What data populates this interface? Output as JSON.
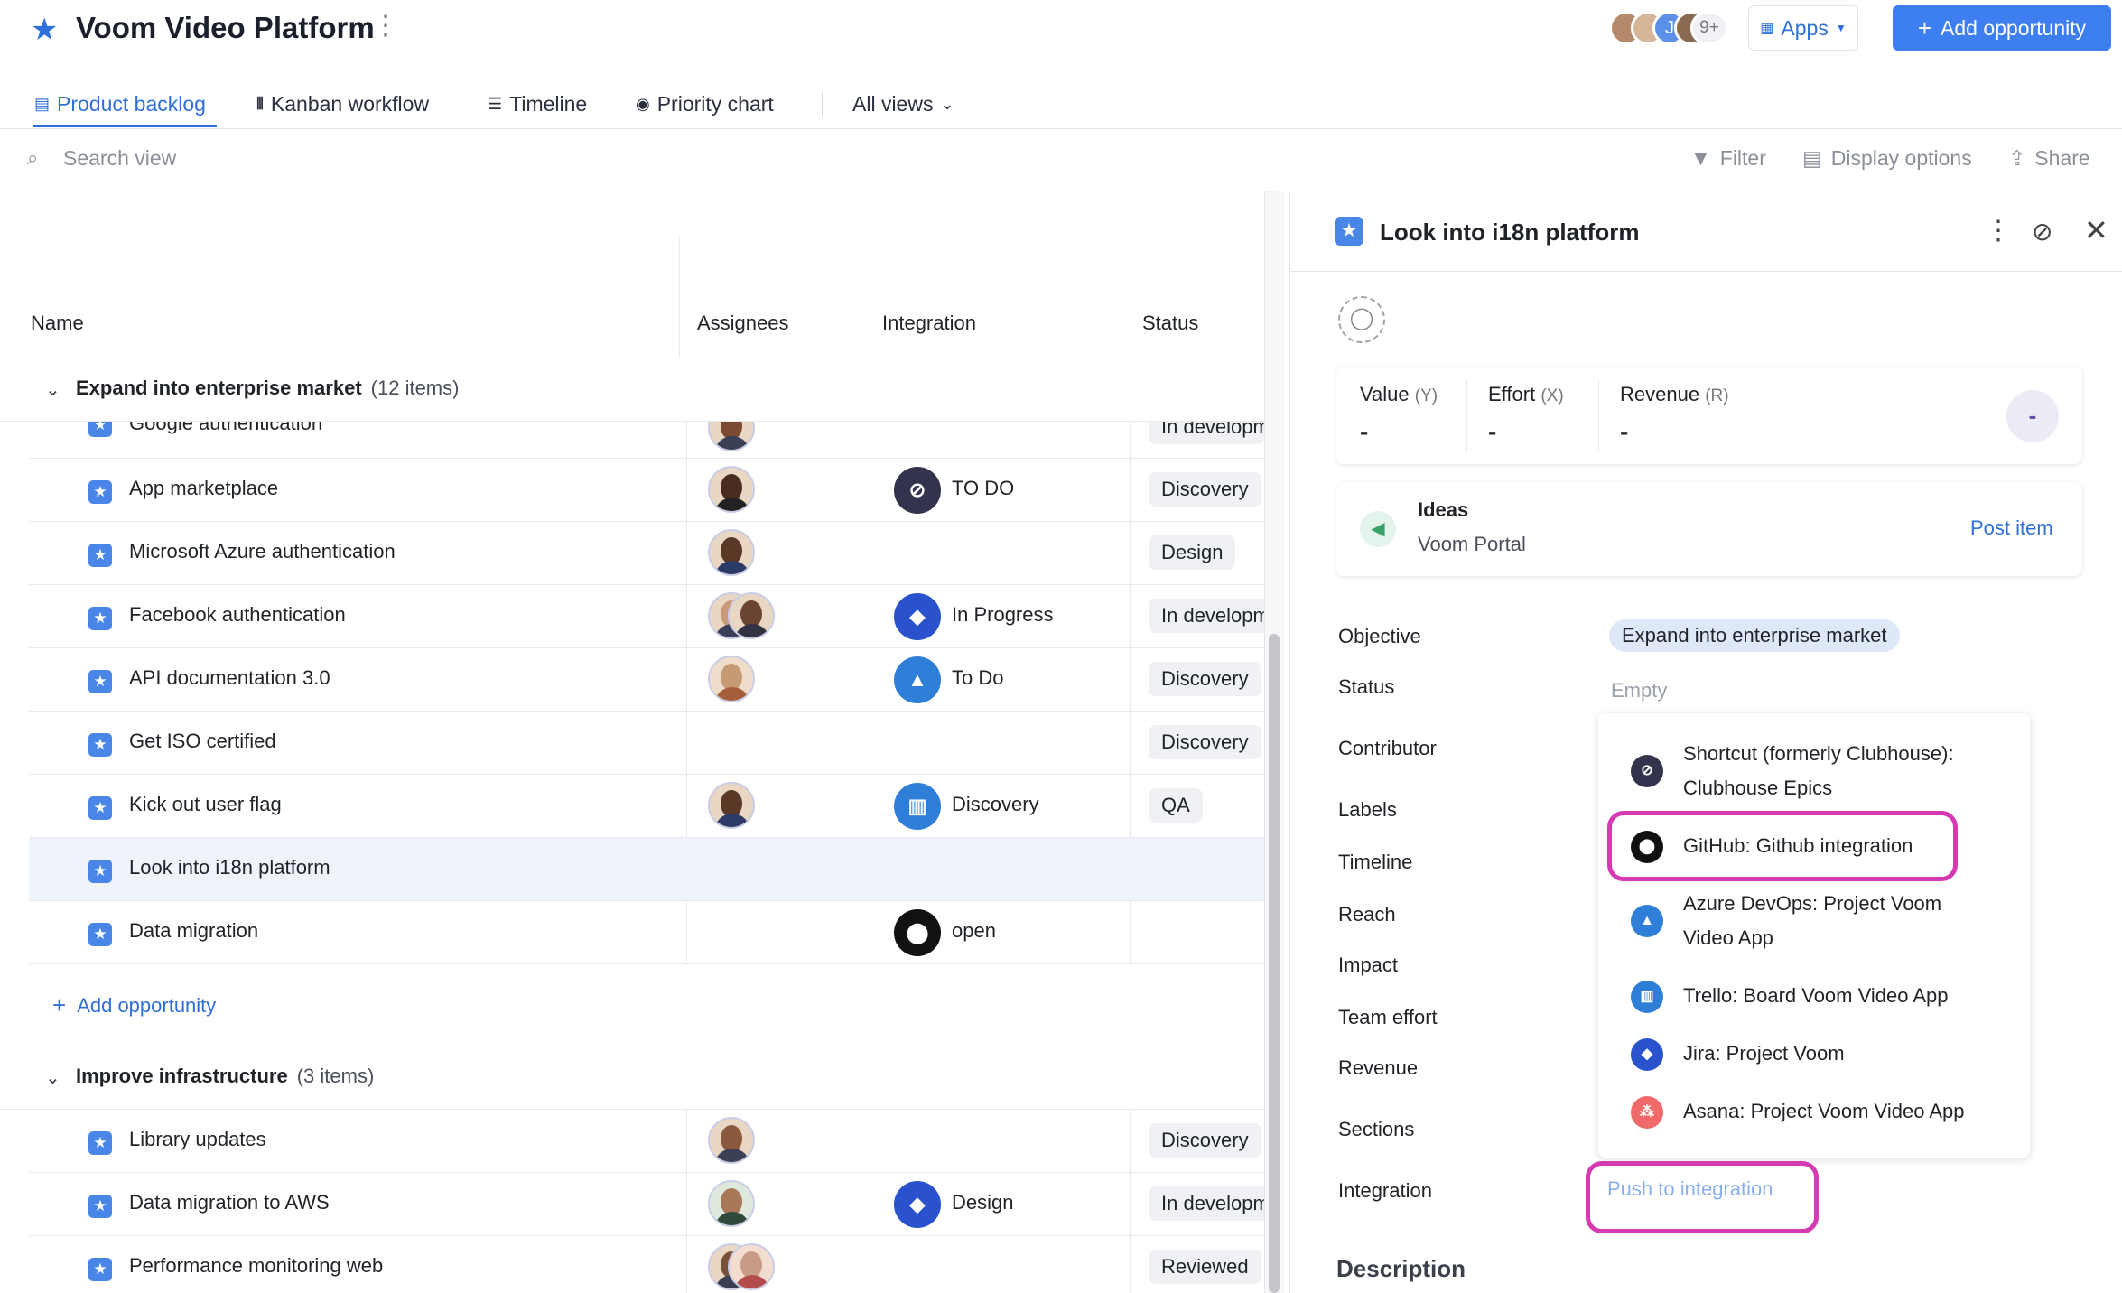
{
  "app": {
    "title": "Voom Video Platform",
    "avatar_overflow": "9+",
    "avatar_initial": "J",
    "apps_label": "Apps",
    "add_opportunity_label": "Add opportunity"
  },
  "tabs": [
    {
      "label": "Product backlog",
      "icon": "table-icon",
      "active": true
    },
    {
      "label": "Kanban workflow",
      "icon": "kanban-icon"
    },
    {
      "label": "Timeline",
      "icon": "timeline-icon"
    },
    {
      "label": "Priority chart",
      "icon": "target-icon"
    },
    {
      "label": "All views",
      "icon": "chevron-down-icon"
    }
  ],
  "toolbar": {
    "search_placeholder": "Search view",
    "filter": "Filter",
    "display_options": "Display options",
    "share": "Share"
  },
  "table": {
    "columns": [
      "Name",
      "Assignees",
      "Integration",
      "Status"
    ],
    "groups": [
      {
        "title": "Expand into enterprise market",
        "count": "(12 items)"
      },
      {
        "title": "Improve infrastructure",
        "count": "(3 items)"
      }
    ],
    "rows": [
      {
        "name": "Google authentication",
        "integration": "",
        "status": "In development"
      },
      {
        "name": "App marketplace",
        "integration": "TO DO",
        "status": "Discovery"
      },
      {
        "name": "Microsoft Azure authentication",
        "integration": "",
        "status": "Design"
      },
      {
        "name": "Facebook authentication",
        "integration": "In Progress",
        "status": "In development"
      },
      {
        "name": "API documentation 3.0",
        "integration": "To Do",
        "status": "Discovery"
      },
      {
        "name": "Get ISO certified",
        "integration": "",
        "status": "Discovery"
      },
      {
        "name": "Kick out user flag",
        "integration": "Discovery",
        "status": "QA"
      },
      {
        "name": "Look into i18n platform",
        "integration": "",
        "status": ""
      },
      {
        "name": "Data migration",
        "integration": "open",
        "status": ""
      }
    ],
    "rows2": [
      {
        "name": "Library updates",
        "integration": "",
        "status": "Discovery"
      },
      {
        "name": "Data migration to AWS",
        "integration": "Design",
        "status": "In development"
      },
      {
        "name": "Performance monitoring web",
        "integration": "",
        "status": "Reviewed"
      }
    ],
    "add_opportunity": "Add opportunity"
  },
  "detail": {
    "title": "Look into i18n platform",
    "scores": [
      {
        "label": "Value",
        "key": "(Y)",
        "value": "-"
      },
      {
        "label": "Effort",
        "key": "(X)",
        "value": "-"
      },
      {
        "label": "Revenue",
        "key": "(R)",
        "value": "-"
      }
    ],
    "score_total": "-",
    "ideas": {
      "title": "Ideas",
      "subtitle": "Voom Portal",
      "action": "Post item"
    },
    "fields": [
      "Objective",
      "Status",
      "Contributor",
      "Labels",
      "Timeline",
      "Reach",
      "Impact",
      "Team effort",
      "Revenue",
      "Sections",
      "Integration"
    ],
    "objective_value": "Expand into enterprise market",
    "status_value": "Empty",
    "push_to_integration": "Push to integration",
    "description_heading": "Description"
  },
  "integration_menu": [
    {
      "label": "Shortcut (formerly Clubhouse): Clubhouse Epics",
      "icon": "shortcut-icon",
      "color": "#33334d"
    },
    {
      "label": "GitHub: Github integration",
      "icon": "github-icon",
      "color": "#111111"
    },
    {
      "label": "Azure DevOps: Project Voom Video App",
      "icon": "azure-devops-icon",
      "color": "#2f7ed8"
    },
    {
      "label": "Trello: Board Voom Video App",
      "icon": "trello-icon",
      "color": "#2f7ed8"
    },
    {
      "label": "Jira: Project Voom",
      "icon": "jira-icon",
      "color": "#2952cc"
    },
    {
      "label": "Asana: Project Voom Video App",
      "icon": "asana-icon",
      "color": "#f06a6a"
    }
  ],
  "colors": {
    "accent": "#4a86e8",
    "highlight": "#d63ab3",
    "selected_row": "#eef3fc"
  }
}
